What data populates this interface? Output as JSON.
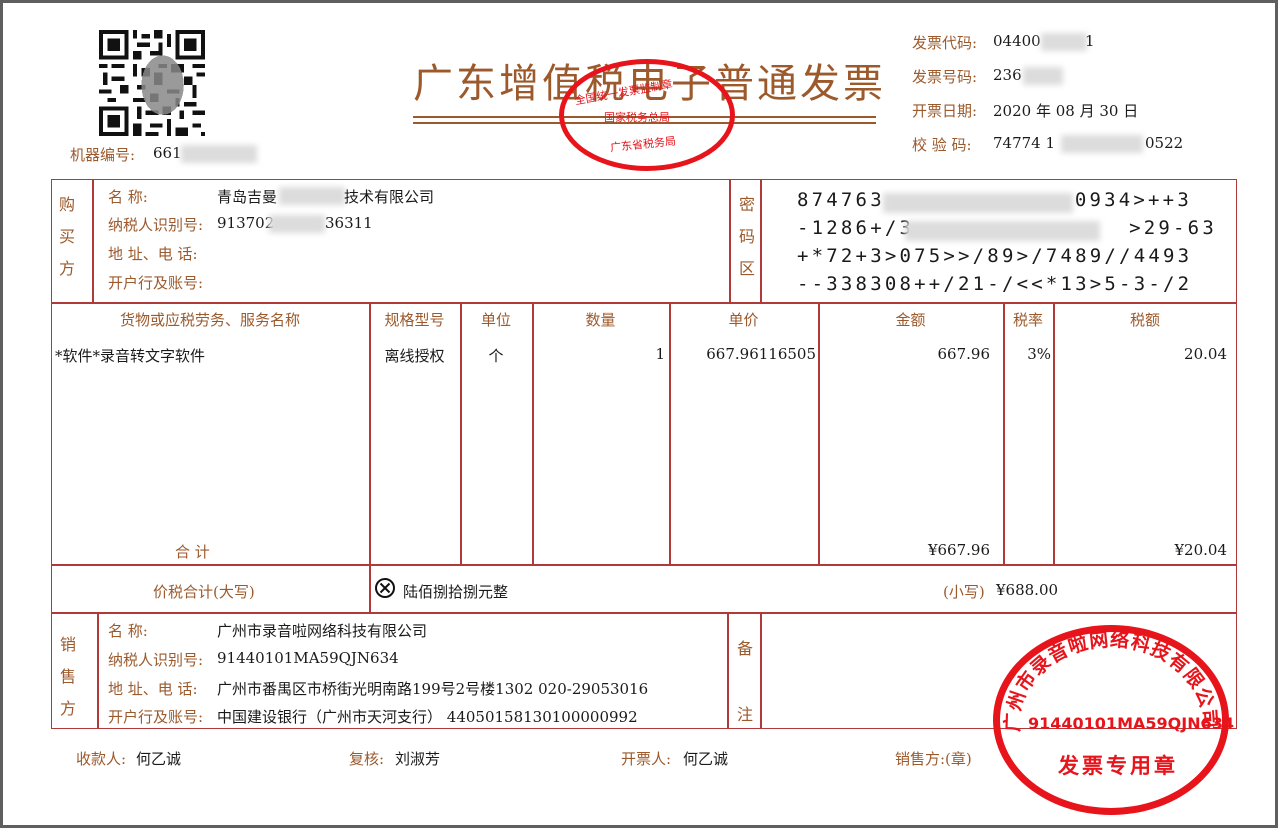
{
  "header": {
    "title": "广东增值税电子普通发票",
    "machine_no_label": "机器编号:",
    "machine_no_value": "661",
    "code_label": "发票代码:",
    "code_value": "04400",
    "code_tail": "1",
    "number_label": "发票号码:",
    "number_value": "236",
    "date_label": "开票日期:",
    "date_value": "2020 年 08 月 30 日",
    "check_label": "校 验 码:",
    "check_head": "74774 1",
    "check_tail": "0522"
  },
  "official_stamp": {
    "line1": "全国统一发票监制章",
    "line2": "国家税务总局",
    "line3": "广东省税务局"
  },
  "buyer": {
    "section": [
      "购",
      "买",
      "方"
    ],
    "name_label": "名        称:",
    "name_head": "青岛吉曼",
    "name_tail": "技术有限公司",
    "taxid_label": "纳税人识别号:",
    "taxid_head": "913702",
    "taxid_tail": "36311",
    "addr_label": "地 址、电 话:",
    "bank_label": "开户行及账号:"
  },
  "cipher": {
    "section": [
      "密",
      "码",
      "区"
    ],
    "lines": [
      [
        "874763",
        "0934>++3"
      ],
      [
        "-1286+/3",
        ">29-63"
      ],
      [
        "+*72+3>075>>/89>/7489//4493",
        ""
      ],
      [
        "--338308++/21-/<<*13>5-3-/2",
        ""
      ]
    ]
  },
  "items": {
    "headers": {
      "name": "货物或应税劳务、服务名称",
      "spec": "规格型号",
      "unit": "单位",
      "qty": "数量",
      "price": "单价",
      "amount": "金额",
      "rate": "税率",
      "tax": "税额"
    },
    "rows": [
      {
        "name": "*软件*录音转文字软件",
        "spec": "离线授权",
        "unit": "个",
        "qty": "1",
        "price": "667.96116505",
        "amount": "667.96",
        "rate": "3%",
        "tax": "20.04"
      }
    ],
    "total_label": "合        计",
    "total_amount": "¥667.96",
    "total_tax": "¥20.04"
  },
  "grand_total": {
    "label": "价税合计(大写)",
    "icon": "cross-circle-icon",
    "words": "陆佰捌拾捌元整",
    "small_label": "(小写)",
    "small_value": "¥688.00"
  },
  "seller": {
    "section": [
      "销",
      "售",
      "方"
    ],
    "name_label": "名        称:",
    "name": "广州市录音啦网络科技有限公司",
    "taxid_label": "纳税人识别号:",
    "taxid": "91440101MA59QJN634",
    "addr_label": "地 址、电 话:",
    "addr": "广州市番禺区市桥街光明南路199号2号楼1302 020-29053016",
    "bank_label": "开户行及账号:",
    "bank": "中国建设银行（广州市天河支行） 44050158130100000992"
  },
  "remarks": {
    "section": [
      "备",
      "注"
    ]
  },
  "seller_stamp": {
    "company": "广州市录音啦网络科技有限公司",
    "taxid": "91440101MA59QJN634",
    "caption": "发票专用章"
  },
  "footer": {
    "payee_label": "收款人:",
    "payee": "何乙诚",
    "reviewer_label": "复核:",
    "reviewer": "刘淑芳",
    "issuer_label": "开票人:",
    "issuer": "何乙诚",
    "seller_label": "销售方:(章)"
  },
  "colors": {
    "frame": "#b03a3a",
    "label": "#9c5a2c",
    "stamp": "#e8141b"
  }
}
